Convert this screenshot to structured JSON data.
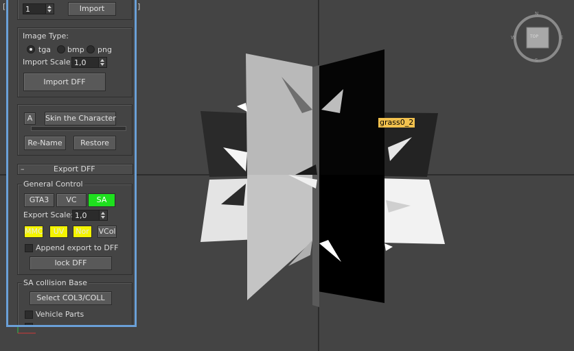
{
  "viewport": {
    "brackets": {
      "left": "[",
      "right": "]"
    },
    "object_label": "grass0_2",
    "navcube": {
      "face": "TOP",
      "compass_n": "N",
      "compass_s": "S",
      "compass_w": "W",
      "compass_e": "E"
    }
  },
  "panel": {
    "top": {
      "spinner_value": "1",
      "import_button": "Import"
    },
    "image_type": {
      "label": "Image Type:",
      "options": [
        "tga",
        "bmp",
        "png"
      ],
      "selected": "tga",
      "scale_label": "Import Scale:",
      "scale_value": "1,0",
      "import_dff_button": "Import DFF"
    },
    "skin": {
      "a_button": "A",
      "skin_button": "Skin the Character",
      "rename_button": "Re-Name",
      "restore_button": "Restore"
    },
    "export_rollout": {
      "toggle": "–",
      "title": "Export DFF"
    },
    "general_control": {
      "title": "General Control",
      "gta3_button": "GTA3",
      "vc_button": "VC",
      "sa_button": "SA",
      "export_scale_label": "Export Scale:",
      "export_scale_value": "1,0",
      "mmc_button": "MMC",
      "uv_button": "UV",
      "nor_button": "Nor",
      "vcol_button": "VCol",
      "append_label": "Append export to DFF",
      "lock_button": "lock DFF"
    },
    "collision": {
      "title": "SA collision Base",
      "select_button": "Select COL3/COLL",
      "vehicle_parts_label": "Vehicle Parts"
    }
  },
  "colors": {
    "viewport_bg": "#444444",
    "panel_border": "#6aa0d8",
    "active_green": "#1ee01e",
    "highlight_yellow": "#f4f400",
    "label_bg": "#f2c14e"
  }
}
